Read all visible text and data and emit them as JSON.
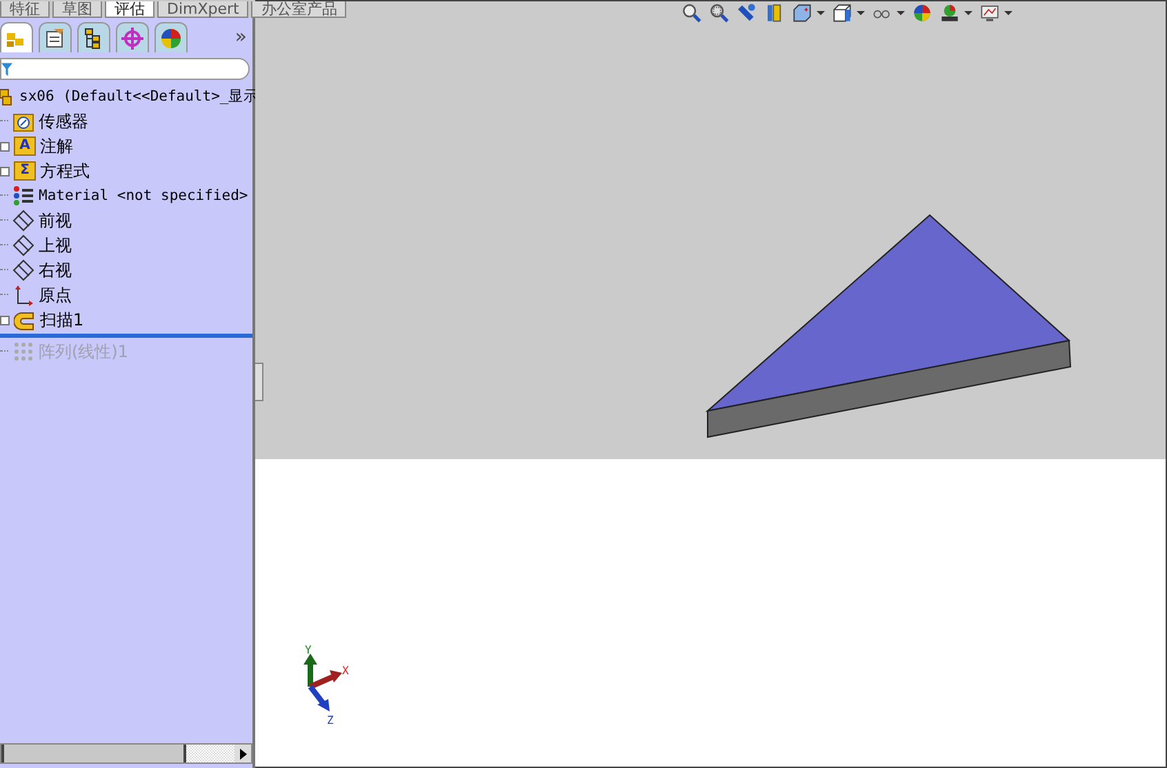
{
  "command_tabs": [
    {
      "label": "特征",
      "selected": false
    },
    {
      "label": "草图",
      "selected": false
    },
    {
      "label": "评估",
      "selected": true
    },
    {
      "label": "DimXpert",
      "selected": false
    },
    {
      "label": "办公室产品",
      "selected": false
    }
  ],
  "panel_tabs": [
    {
      "kind": "tree",
      "selected": true
    },
    {
      "kind": "property",
      "selected": false
    },
    {
      "kind": "config",
      "selected": false
    },
    {
      "kind": "target",
      "selected": false
    },
    {
      "kind": "display",
      "selected": false
    }
  ],
  "panel_more": "»",
  "tree": {
    "root": "sx06  (Default<<Default>_显示",
    "items": [
      {
        "kind": "sensor",
        "label": "传感器",
        "expandable": false,
        "disabled": false
      },
      {
        "kind": "annotation",
        "icon_letter": "A",
        "label": "注解",
        "expandable": true,
        "disabled": false
      },
      {
        "kind": "equation",
        "icon_letter": "Σ",
        "label": "方程式",
        "expandable": true,
        "disabled": false
      },
      {
        "kind": "material",
        "label": "Material <not specified>",
        "expandable": false,
        "disabled": false
      },
      {
        "kind": "plane",
        "label": "前视",
        "expandable": false,
        "disabled": false
      },
      {
        "kind": "plane",
        "label": "上视",
        "expandable": false,
        "disabled": false
      },
      {
        "kind": "plane",
        "label": "右视",
        "expandable": false,
        "disabled": false
      },
      {
        "kind": "origin",
        "label": "原点",
        "expandable": false,
        "disabled": false
      },
      {
        "kind": "sweep",
        "label": "扫描1",
        "expandable": true,
        "disabled": false
      },
      {
        "kind": "rollback"
      },
      {
        "kind": "pattern",
        "label": "阵列(线性)1",
        "expandable": false,
        "disabled": true
      }
    ]
  },
  "toolbar": [
    {
      "kind": "zoom-fit",
      "dropdown": false
    },
    {
      "kind": "zoom-area",
      "dropdown": false
    },
    {
      "kind": "previous-view",
      "dropdown": false
    },
    {
      "kind": "section",
      "dropdown": false
    },
    {
      "kind": "view-orient",
      "dropdown": true
    },
    {
      "kind": "display-style",
      "dropdown": true
    },
    {
      "kind": "hide-show",
      "dropdown": true
    },
    {
      "kind": "appearance",
      "dropdown": false
    },
    {
      "kind": "scene",
      "dropdown": true
    },
    {
      "kind": "view-settings",
      "dropdown": true
    }
  ],
  "triad": {
    "x": "X",
    "y": "Y",
    "z": "Z"
  }
}
